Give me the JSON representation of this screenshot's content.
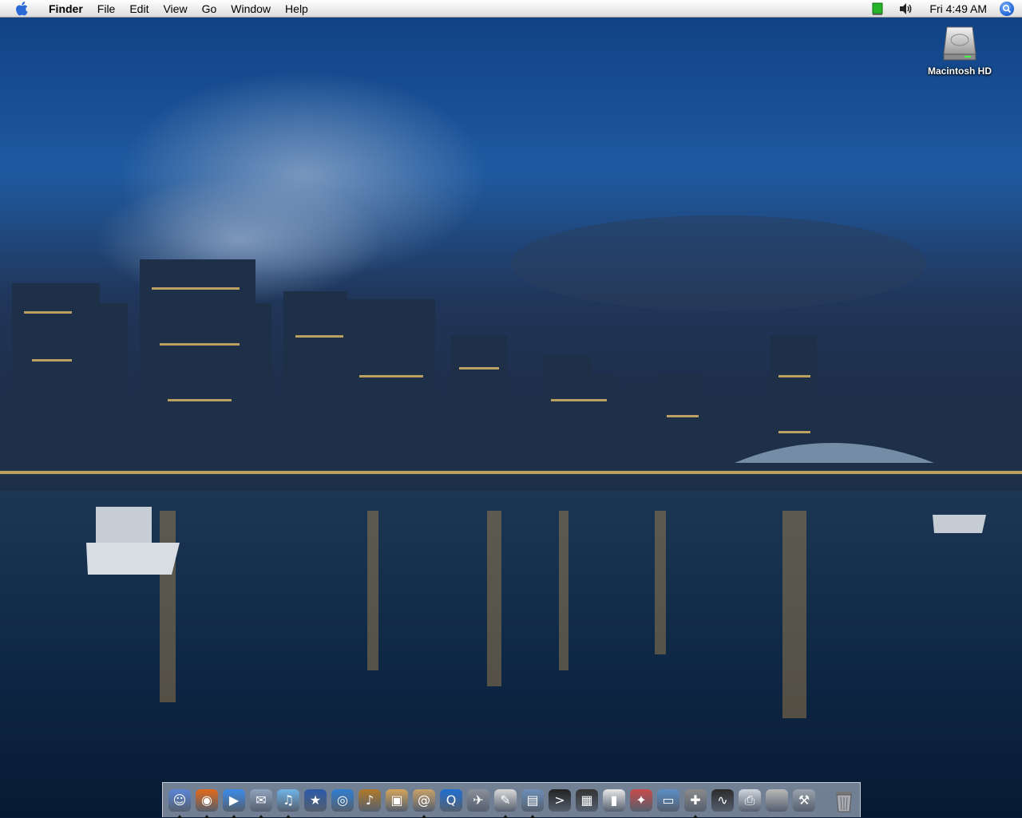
{
  "menubar": {
    "apple_icon": "apple-icon",
    "app_name": "Finder",
    "menus": [
      "File",
      "Edit",
      "View",
      "Go",
      "Window",
      "Help"
    ],
    "status_icons": [
      "battery-icon",
      "volume-icon"
    ],
    "clock": "Fri 4:49 AM",
    "spotlight_icon": "spotlight-icon"
  },
  "desktop": {
    "icons": [
      {
        "label": "Macintosh HD",
        "icon": "hard-drive-icon"
      }
    ]
  },
  "dock": {
    "items": [
      {
        "name": "finder",
        "icon": "finder-icon",
        "running": true,
        "color": "#5a86d6",
        "glyph": "☺"
      },
      {
        "name": "firefox",
        "icon": "firefox-icon",
        "running": true,
        "color": "#e36a1a",
        "glyph": "◉"
      },
      {
        "name": "ichat",
        "icon": "ichat-icon",
        "running": true,
        "color": "#3b8bea",
        "glyph": "▶"
      },
      {
        "name": "mail",
        "icon": "mail-icon",
        "running": true,
        "color": "#8fa3bd",
        "glyph": "✉"
      },
      {
        "name": "itunes",
        "icon": "itunes-icon",
        "running": true,
        "color": "#6fb3e8",
        "glyph": "♫"
      },
      {
        "name": "imovie",
        "icon": "imovie-icon",
        "running": false,
        "color": "#2a5aa8",
        "glyph": "★"
      },
      {
        "name": "idvd",
        "icon": "idvd-icon",
        "running": false,
        "color": "#2f7fd0",
        "glyph": "◎"
      },
      {
        "name": "garageband",
        "icon": "garageband-icon",
        "running": false,
        "color": "#b07a2a",
        "glyph": "♪"
      },
      {
        "name": "iphoto",
        "icon": "iphoto-icon",
        "running": false,
        "color": "#d4a45a",
        "glyph": "▣"
      },
      {
        "name": "address-book",
        "icon": "address-book-icon",
        "running": true,
        "color": "#c9a16a",
        "glyph": "@"
      },
      {
        "name": "quicktime",
        "icon": "quicktime-icon",
        "running": false,
        "color": "#1f6fd1",
        "glyph": "Q"
      },
      {
        "name": "automator",
        "icon": "automator-icon",
        "running": false,
        "color": "#8a8f99",
        "glyph": "✈"
      },
      {
        "name": "textedit",
        "icon": "textedit-icon",
        "running": true,
        "color": "#d9d9d9",
        "glyph": "✎"
      },
      {
        "name": "preview",
        "icon": "preview-icon",
        "running": true,
        "color": "#6d8fb8",
        "glyph": "▤"
      },
      {
        "name": "terminal",
        "icon": "terminal-icon",
        "running": false,
        "color": "#222222",
        "glyph": ">"
      },
      {
        "name": "clapper",
        "icon": "clapper-icon",
        "running": false,
        "color": "#333333",
        "glyph": "▦"
      },
      {
        "name": "ipod",
        "icon": "ipod-icon",
        "running": false,
        "color": "#e8e8e8",
        "glyph": "▮"
      },
      {
        "name": "hair-dryer",
        "icon": "hair-dryer-icon",
        "running": false,
        "color": "#c94a4a",
        "glyph": "✦"
      },
      {
        "name": "system-profiler",
        "icon": "system-profiler-icon",
        "running": false,
        "color": "#5b8fc7",
        "glyph": "▭"
      },
      {
        "name": "disk-utility",
        "icon": "disk-utility-icon",
        "running": true,
        "color": "#8b8b8b",
        "glyph": "✚"
      },
      {
        "name": "activity-monitor",
        "icon": "activity-monitor-icon",
        "running": false,
        "color": "#2b2b2b",
        "glyph": "∿"
      },
      {
        "name": "printer",
        "icon": "printer-icon",
        "running": false,
        "color": "#cfd6de",
        "glyph": "⎙"
      },
      {
        "name": "boot-camp",
        "icon": "boot-camp-icon",
        "running": false,
        "color": "#b9b9b9",
        "glyph": ""
      },
      {
        "name": "xcode-tool",
        "icon": "tool-icon",
        "running": false,
        "color": "#9aa3ad",
        "glyph": "⚒"
      }
    ],
    "trash": {
      "icon": "trash-icon"
    }
  }
}
